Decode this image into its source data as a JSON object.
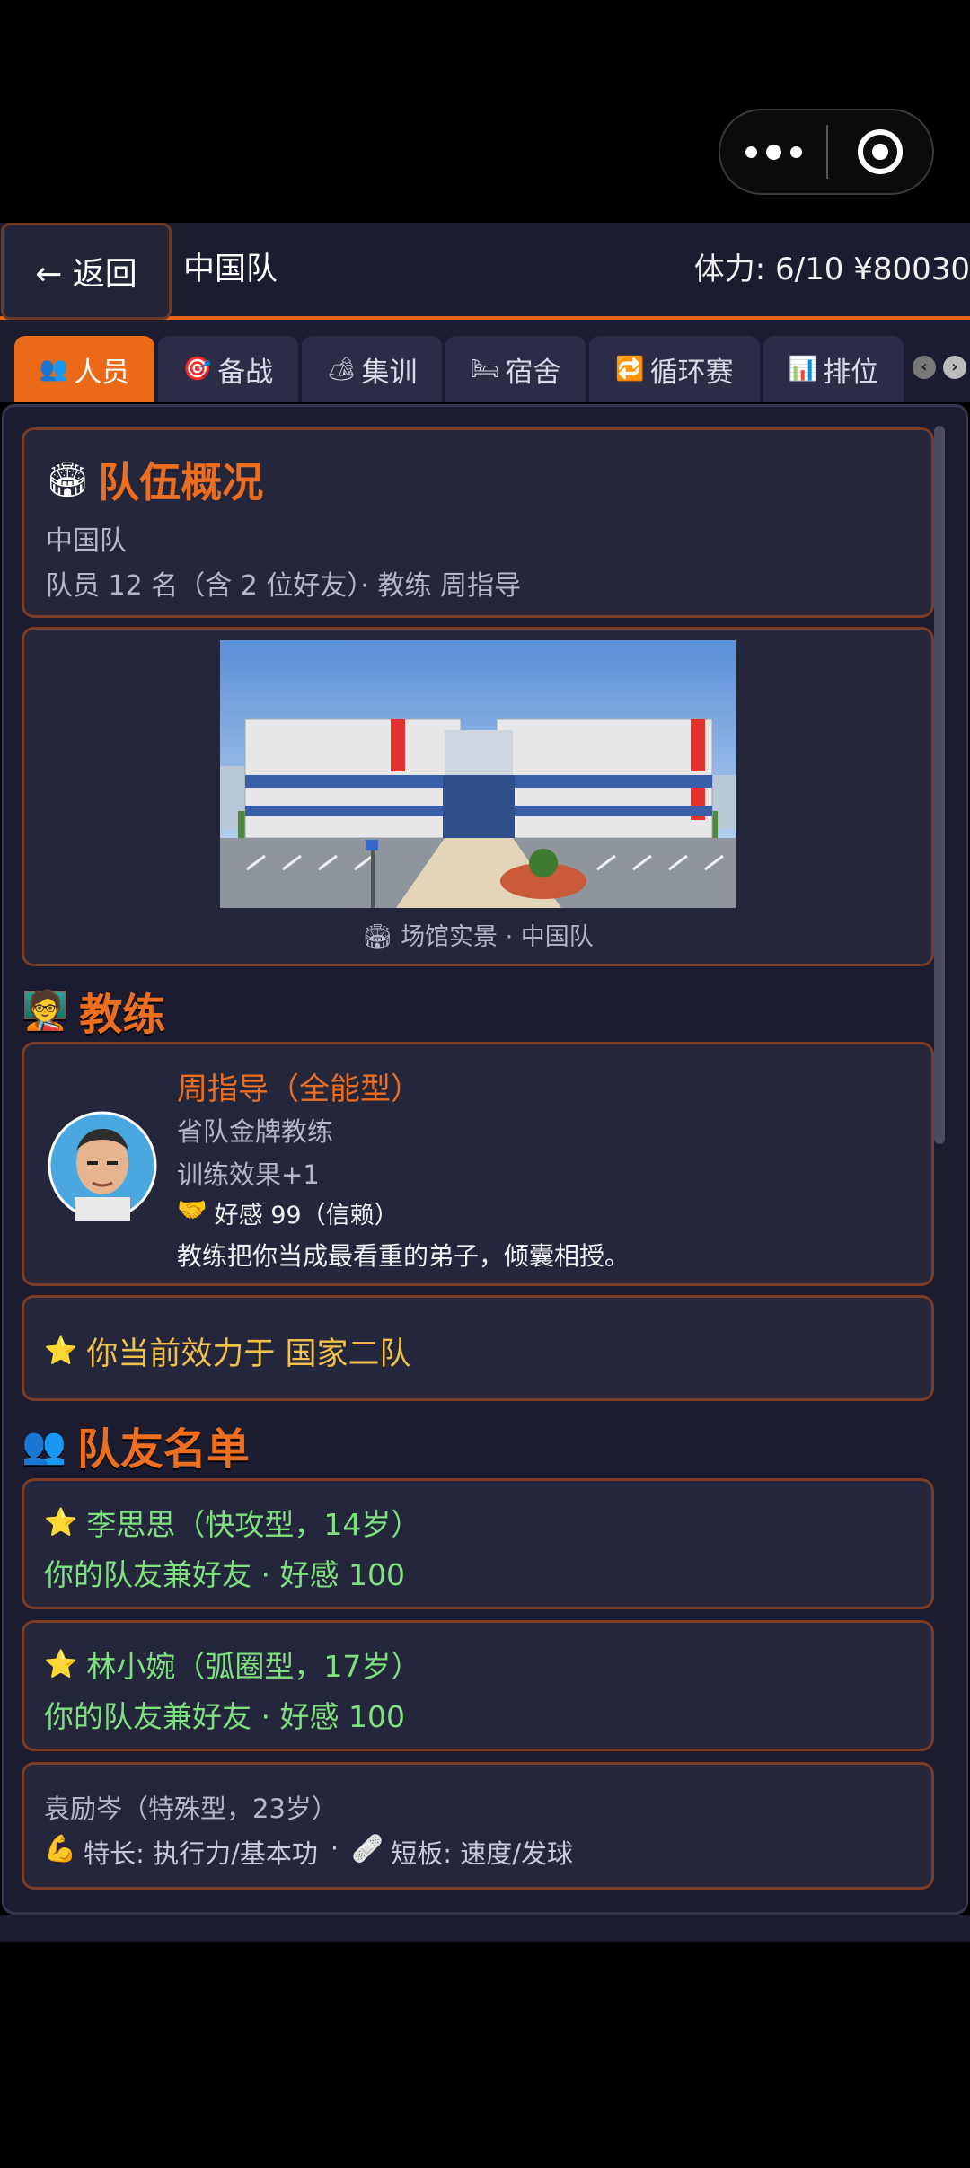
{
  "header": {
    "back_label": "← 返回",
    "team_name": "中国队",
    "stats": "体力: 6/10 ¥80030"
  },
  "tabs": [
    {
      "icon": "👥",
      "label": "人员",
      "active": true
    },
    {
      "icon": "🎯",
      "label": "备战"
    },
    {
      "icon": "🏕",
      "label": "集训"
    },
    {
      "icon": "🛏",
      "label": "宿舍"
    },
    {
      "icon": "🔁",
      "label": "循环赛"
    },
    {
      "icon": "📊",
      "label": "排位"
    }
  ],
  "overview": {
    "icon": "🏟",
    "title": "队伍概况",
    "team": "中国队",
    "summary": "队员 12 名（含 2 位好友）· 教练 周指导"
  },
  "venue": {
    "caption_icon": "🏟",
    "caption": "场馆实景 · 中国队"
  },
  "coach_section": {
    "icon": "🧑‍🏫",
    "title": "教练"
  },
  "coach": {
    "name": "周指导（全能型）",
    "rank": "省队金牌教练",
    "effect": "训练效果+1",
    "favor_icon": "🤝",
    "favor": "好感 99（信赖）",
    "note": "教练把你当成最看重的弟子，倾囊相授。"
  },
  "team_status": {
    "icon": "⭐",
    "text": "你当前效力于 国家二队"
  },
  "roster_section": {
    "icon": "👥",
    "title": "队友名单"
  },
  "roster": [
    {
      "icon": "⭐",
      "name": "李思思（快攻型，14岁）",
      "detail": "你的队友兼好友 · 好感 100"
    },
    {
      "icon": "⭐",
      "name": "林小婉（弧圈型，17岁）",
      "detail": "你的队友兼好友 · 好感 100"
    },
    {
      "name": "袁励岑（特殊型，23岁）",
      "strength_icon": "💪",
      "strength": "特长: 执行力/基本功",
      "dot": "·",
      "weakness_icon": "🩹",
      "weakness": "短板: 速度/发球"
    }
  ]
}
